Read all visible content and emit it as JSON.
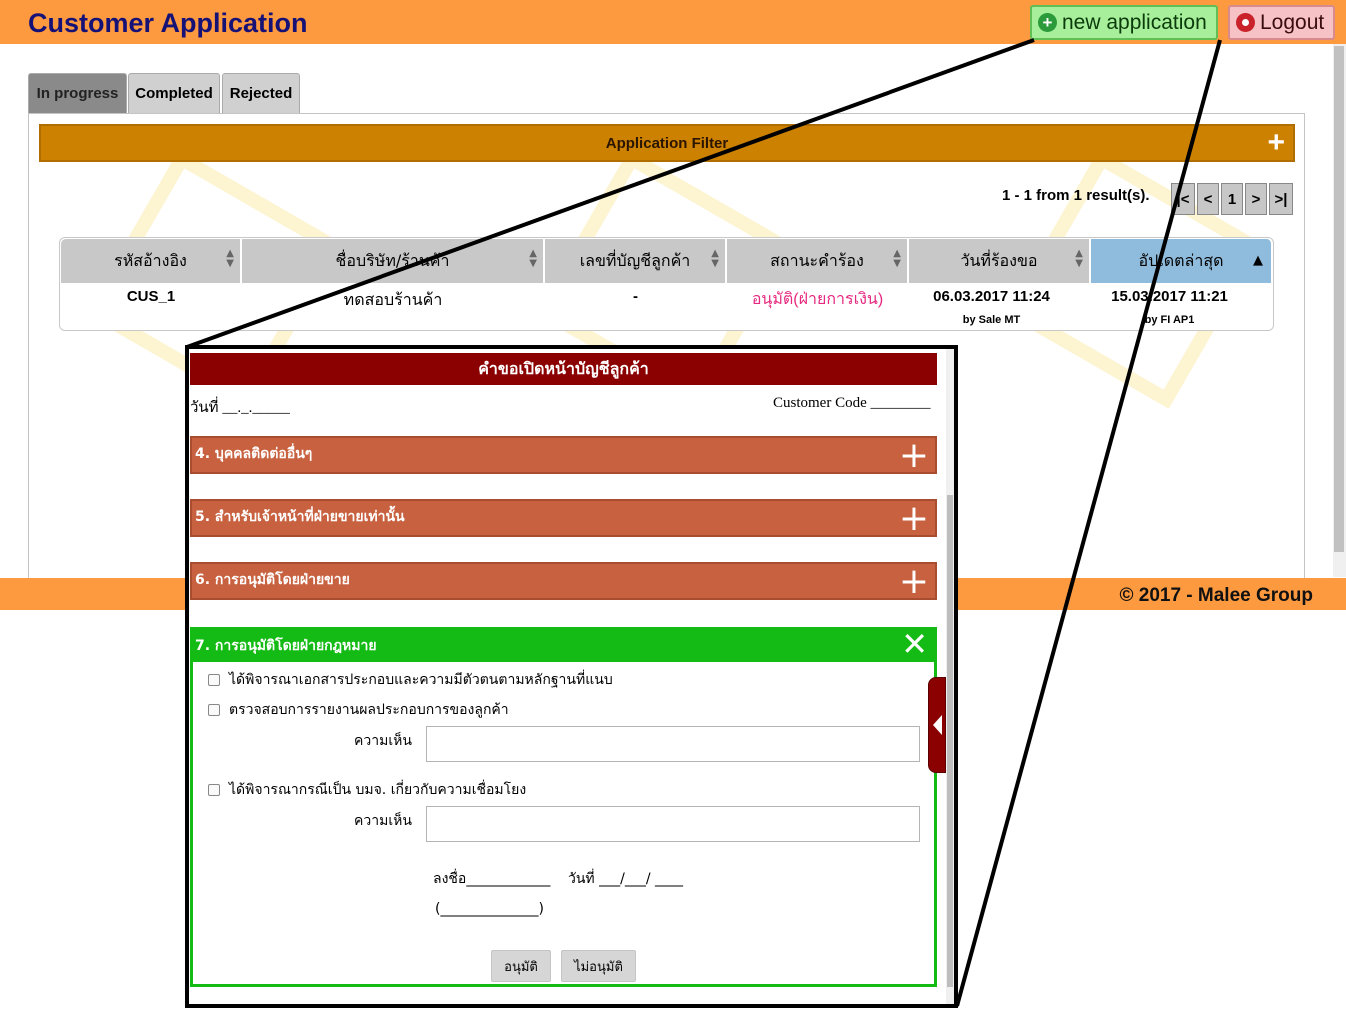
{
  "header": {
    "title": "Customer Application",
    "new_label": "new application",
    "logout_label": "Logout"
  },
  "tabs": [
    {
      "label": "In progress",
      "active": true
    },
    {
      "label": "Completed",
      "active": false
    },
    {
      "label": "Rejected",
      "active": false
    }
  ],
  "filter": {
    "label": "Application Filter",
    "toggle": "+"
  },
  "pager": {
    "summary": "1 - 1 from 1 result(s).",
    "first": "|<",
    "prev": "<",
    "page": "1",
    "next": ">",
    "last": ">|"
  },
  "table": {
    "columns": [
      "รหัสอ้างอิง",
      "ชื่อบริษัท/ร้านค้า",
      "เลขที่บัญชีลูกค้า",
      "สถานะคำร้อง",
      "วันที่ร้องขอ",
      "อัปเดตล่าสุด"
    ],
    "sorted_column": "อัปเดตล่าสุด",
    "rows": [
      {
        "ref": "CUS_1",
        "company": "ทดสอบร้านค้า",
        "account": "-",
        "status": "อนุมัติ(ฝ่ายการเงิน)",
        "requested": "06.03.2017 11:24",
        "requested_by": "by Sale MT",
        "updated": "15.03.2017 11:21",
        "updated_by": "by FI AP1"
      }
    ]
  },
  "footer": {
    "copyright": "© 2017 - Malee Group"
  },
  "form": {
    "title": "คำขอเปิดหน้าบัญชีลูกค้า",
    "date_label": "วันที่ __._._____",
    "customer_code": "Customer Code ________",
    "sections": [
      {
        "label": "4. บุคคลติดต่ออื่นๆ",
        "toggle": "+"
      },
      {
        "label": "5. สำหรับเจ้าหน้าที่ฝ่ายขายเท่านั้น",
        "toggle": "+"
      },
      {
        "label": "6. การอนุมัติโดยฝ่ายขาย",
        "toggle": "+"
      }
    ],
    "legal": {
      "label": "7. การอนุมัติโดยฝ่ายกฎหมาย",
      "close": "✕",
      "check1": "ได้พิจารณาเอกสารประกอบและความมีตัวตนตามหลักฐานที่แนบ",
      "check2": "ตรวจสอบการรายงานผลประกอบการของลูกค้า",
      "comment_label": "ความเห็น",
      "check3": "ได้พิจารณากรณีเป็น บมจ. เกี่ยวกับความเชื่อมโยง",
      "comment_label2": "ความเห็น",
      "sign": "ลงชื่อ____________",
      "sign_date": "วันที่ ___/___/ ____",
      "sign_name": "(______________)",
      "approve": "อนุมัติ",
      "reject": "ไม่อนุมัติ"
    }
  },
  "colors": {
    "header_bg": "#fd9a3f",
    "title": "#151177",
    "filter_bar": "#cc8100",
    "form_title": "#8b0000",
    "section": "#c8613f",
    "legal_section": "#14bb14",
    "status_approved": "#e6287f",
    "sorted_header": "#8fbbdc"
  }
}
